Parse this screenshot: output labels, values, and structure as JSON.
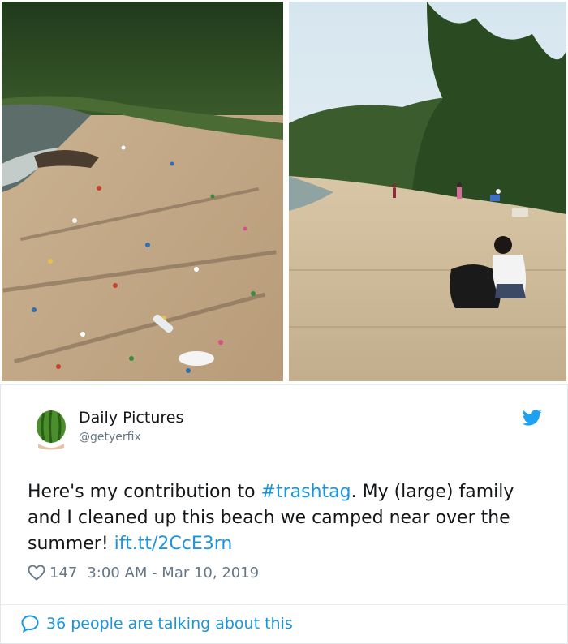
{
  "photos": {
    "before": {
      "icon": "beach-covered-in-trash-photo"
    },
    "after": {
      "icon": "clean-beach-photo"
    }
  },
  "tweet": {
    "author": {
      "name": "Daily Pictures",
      "handle": "@getyerfix",
      "avatar_icon": "watermelon-avatar"
    },
    "text": {
      "part1": "Here's my contribution to ",
      "hashtag": "#trashtag",
      "part2": ". My (large) family and I cleaned up this beach we camped near over the summer! ",
      "link": "ift.tt/2CcE3rn"
    },
    "likes": "147",
    "timestamp": "3:00 AM - Mar 10, 2019",
    "talking": "36 people are talking about this",
    "colors": {
      "link": "#1b95e0",
      "secondary": "#657786",
      "twitter_blue": "#1da1f2"
    }
  }
}
